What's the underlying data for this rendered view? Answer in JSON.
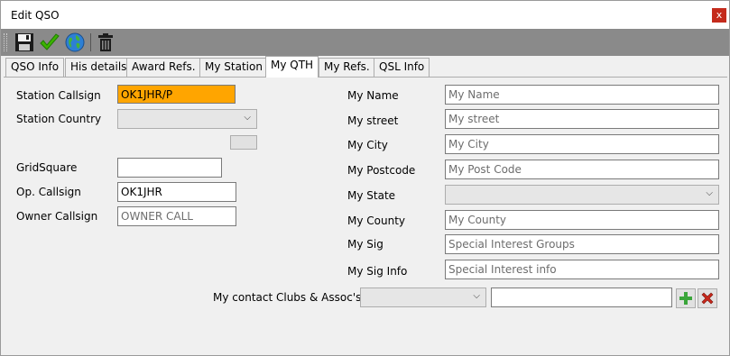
{
  "window": {
    "title": "Edit QSO",
    "close_symbol": "x"
  },
  "toolbar": {
    "buttons": [
      {
        "name": "save-icon"
      },
      {
        "name": "check-icon"
      },
      {
        "name": "globe-icon"
      },
      {
        "name": "trash-icon"
      }
    ]
  },
  "tabs": [
    "QSO Info",
    "His details",
    "Award Refs.",
    "My Station",
    "My QTH",
    "My Refs.",
    "QSL Info"
  ],
  "active_tab": "My QTH",
  "left": {
    "station_callsign_label": "Station Callsign",
    "station_callsign_value": "OK1JHR/P",
    "station_country_label": "Station Country",
    "station_country_value": "",
    "gridsquare_label": "GridSquare",
    "gridsquare_value": "",
    "op_callsign_label": "Op. Callsign",
    "op_callsign_value": "OK1JHR",
    "owner_callsign_label": "Owner Callsign",
    "owner_callsign_placeholder": "OWNER CALL"
  },
  "right": {
    "my_name_label": "My Name",
    "my_name_placeholder": "My Name",
    "my_street_label": "My street",
    "my_street_placeholder": "My street",
    "my_city_label": "My City",
    "my_city_placeholder": "My City",
    "my_postcode_label": "My Postcode",
    "my_postcode_placeholder": "My Post Code",
    "my_state_label": "My State",
    "my_state_value": "",
    "my_county_label": "My County",
    "my_county_placeholder": "My County",
    "my_sig_label": "My Sig",
    "my_sig_placeholder": "Special Interest Groups",
    "my_sig_info_label": "My Sig Info",
    "my_sig_info_placeholder": "Special Interest info"
  },
  "clubs": {
    "label": "My contact Clubs & Assoc's",
    "combo_value": "",
    "text_value": ""
  },
  "colors": {
    "toolbar_bg": "#8a8a8a",
    "callsign_highlight": "#ffa500",
    "close_red": "#c42b1c"
  }
}
